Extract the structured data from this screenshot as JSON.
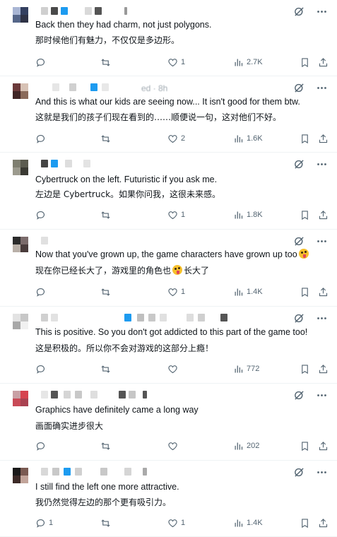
{
  "tweets": [
    {
      "ghost_header": "",
      "text_en": "Back then they had charm, not just polygons.",
      "text_zh": "那时候他们有魅力，不仅仅是多边形。",
      "replies": "",
      "retweets": "",
      "likes": "1",
      "views": "2.7K"
    },
    {
      "ghost_header": "ed · 8h",
      "text_en": "And this is what our kids are seeing now... It isn't good for them btw.",
      "text_zh": "这就是我们的孩子们现在看到的……顺便说一句，这对他们不好。",
      "replies": "",
      "retweets": "",
      "likes": "2",
      "views": "1.6K"
    },
    {
      "ghost_header": "",
      "text_en": "Cybertruck on the left. Futuristic if you ask me.",
      "text_zh": "左边是 Cybertruck。如果你问我，这很未来感。",
      "replies": "",
      "retweets": "",
      "likes": "1",
      "views": "1.8K"
    },
    {
      "ghost_header": "",
      "text_en": "Now that you've grown up, the game characters have grown up too",
      "text_zh_pre": "现在你已经长大了，游戏里的角色也",
      "text_zh_post": "长大了",
      "replies": "",
      "retweets": "",
      "likes": "1",
      "views": "1.4K"
    },
    {
      "ghost_header": "",
      "text_en": "This is positive. So you don't got addicted to this part of the game too!",
      "text_zh": "这是积极的。所以你不会对游戏的这部分上瘾！",
      "replies": "",
      "retweets": "",
      "likes": "",
      "views": "772"
    },
    {
      "ghost_header": "",
      "text_en": "Graphics have definitely came a long way",
      "text_zh": "画面确实进步很大",
      "replies": "",
      "retweets": "",
      "likes": "",
      "views": "202"
    },
    {
      "ghost_header": "",
      "text_en": "I still find the left one more attractive.",
      "text_zh": "我仍然觉得左边的那个更有吸引力。",
      "replies": "1",
      "retweets": "",
      "likes": "1",
      "views": "1.4K"
    }
  ],
  "icons": {
    "reply": "reply-icon",
    "retweet": "retweet-icon",
    "like": "heart-icon",
    "views": "views-icon",
    "bookmark": "bookmark-icon",
    "share": "share-icon",
    "grok": "grok-icon",
    "more": "more-icon"
  },
  "colors": {
    "text": "#0f1419",
    "muted": "#536471",
    "divider": "#eff3f4",
    "link_blue": "#1d9bf0"
  }
}
